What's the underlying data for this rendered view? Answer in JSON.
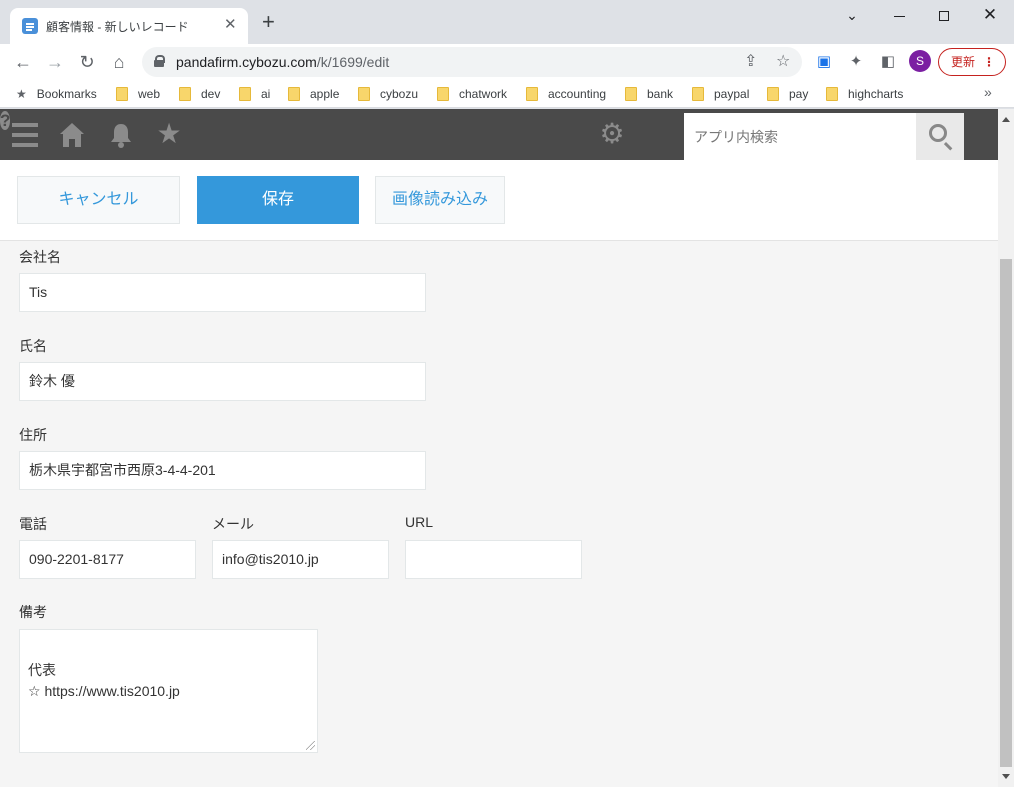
{
  "browser": {
    "tab_title": "顧客情報 - 新しいレコード",
    "url_host": "pandafirm.cybozu.com",
    "url_path": "/k/1699/edit",
    "profile_initial": "S",
    "update_label": "更新",
    "bookmarks": [
      "Bookmarks",
      "web",
      "dev",
      "ai",
      "apple",
      "cybozu",
      "chatwork",
      "accounting",
      "bank",
      "paypal",
      "pay",
      "highcharts"
    ]
  },
  "header": {
    "search_placeholder": "アプリ内検索"
  },
  "actions": {
    "cancel": "キャンセル",
    "save": "保存",
    "import_image": "画像読み込み"
  },
  "form": {
    "company": {
      "label": "会社名",
      "value": "Tis"
    },
    "name": {
      "label": "氏名",
      "value": "鈴木 優"
    },
    "address": {
      "label": "住所",
      "value": "栃木県宇都宮市西原3-4-4-201"
    },
    "phone": {
      "label": "電話",
      "value": "090-2201-8177"
    },
    "email": {
      "label": "メール",
      "value": "info@tis2010.jp"
    },
    "url": {
      "label": "URL",
      "value": ""
    },
    "notes": {
      "label": "備考",
      "value": "代表\n☆ https://www.tis2010.jp"
    }
  },
  "colors": {
    "primary": "#3498db",
    "header_bg": "#4a4a4a",
    "page_bg": "#f5f5f5"
  }
}
